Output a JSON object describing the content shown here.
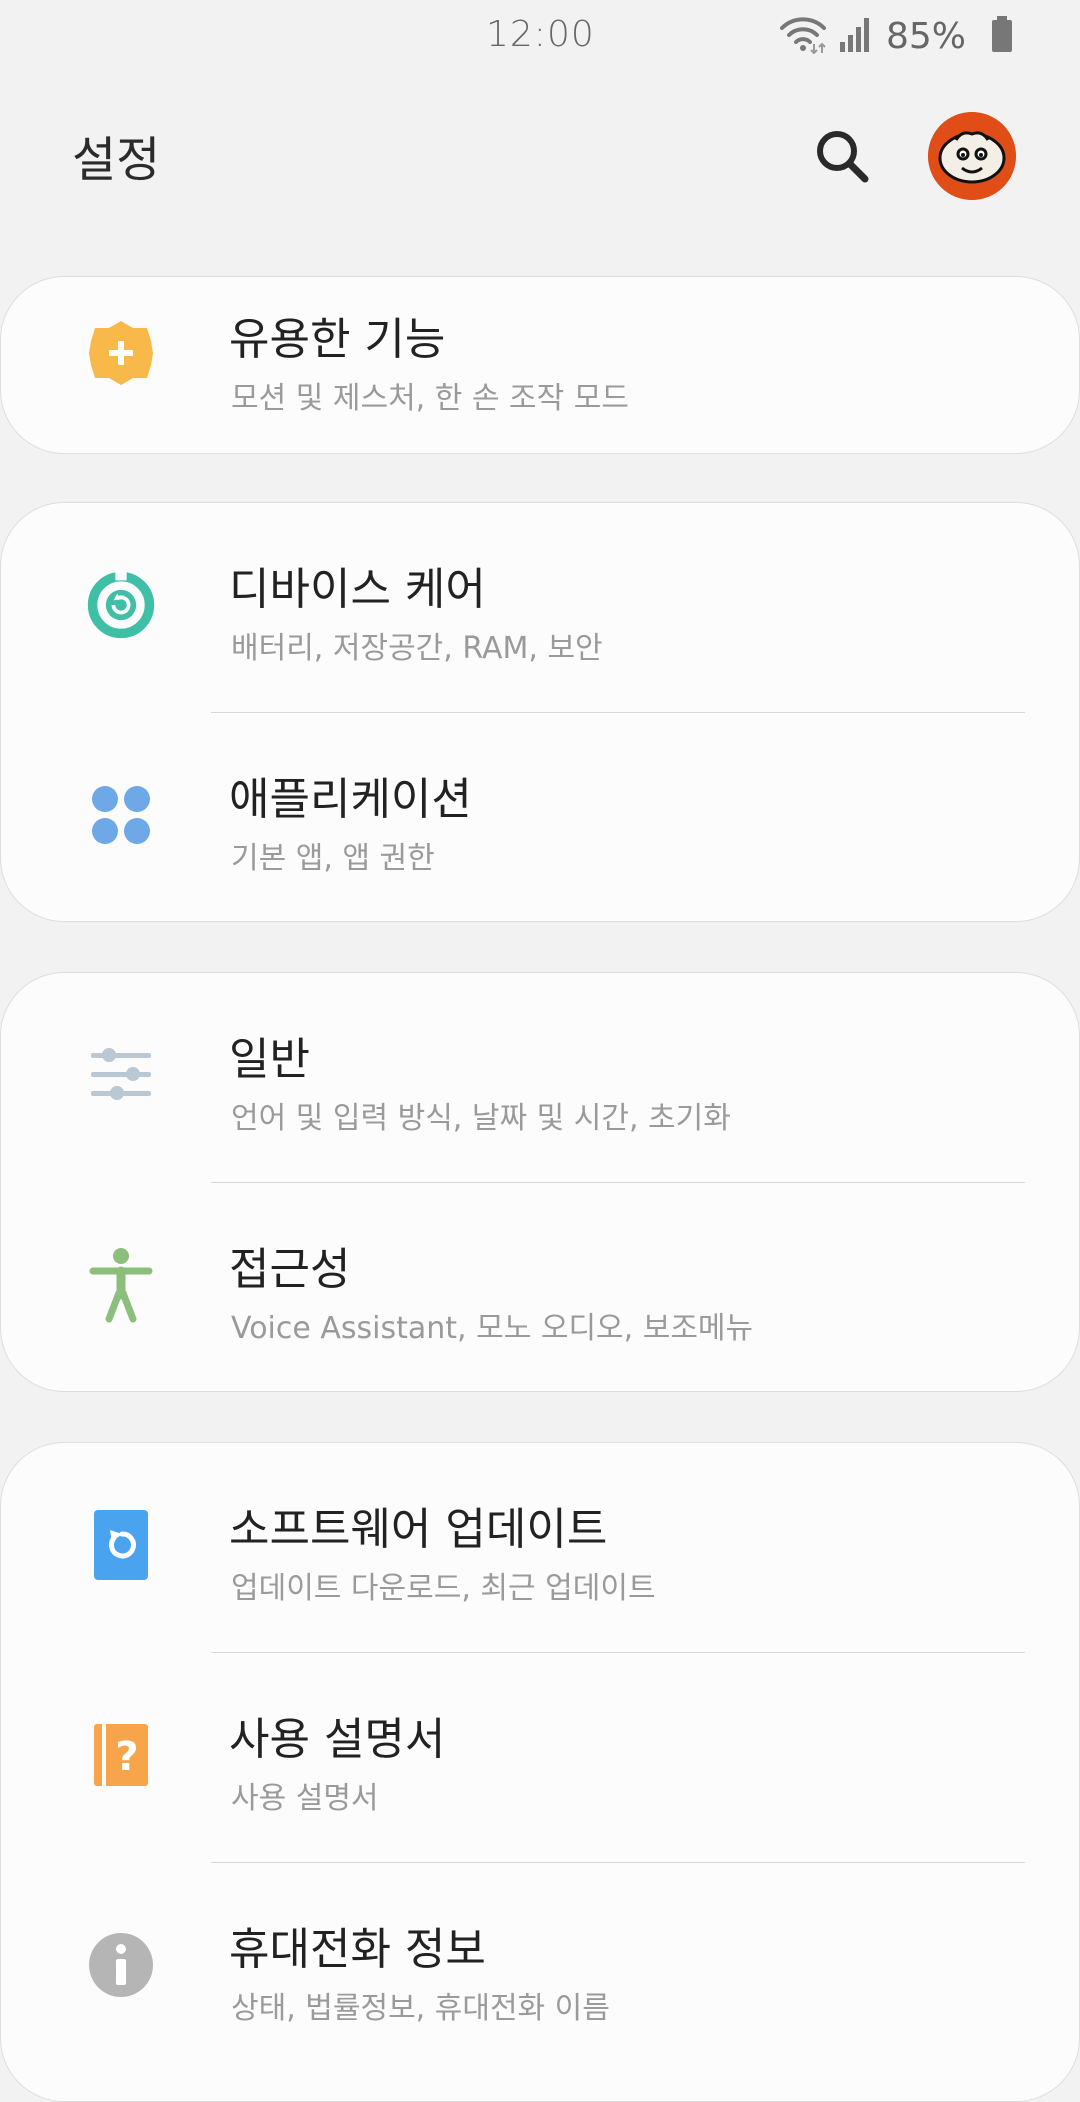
{
  "status_bar": {
    "time": "12:00",
    "battery_text": "85%",
    "icons": [
      "wifi-icon",
      "signal-icon",
      "battery-icon"
    ]
  },
  "header": {
    "title": "설정",
    "search_icon": "search-icon",
    "avatar_icon": "avatar-icon"
  },
  "colors": {
    "background": "#f2f2f2",
    "card": "#fcfcfc",
    "useful_features": "#f8b84a",
    "device_care": "#3fbfa5",
    "applications": "#6ea8e6",
    "general": "#b9c8d2",
    "accessibility": "#8cbf7c",
    "software_update": "#4aa3ee",
    "user_manual": "#f7a44a",
    "about_phone": "#b5b5b5",
    "avatar": "#e04d16"
  },
  "sections": [
    {
      "items": [
        {
          "title": "유용한 기능",
          "subtitle": "모션 및 제스처, 한 손 조작 모드",
          "icon": "gear-plus-icon"
        }
      ]
    },
    {
      "items": [
        {
          "title": "디바이스 케어",
          "subtitle": "배터리, 저장공간, RAM, 보안",
          "icon": "device-care-icon"
        },
        {
          "title": "애플리케이션",
          "subtitle": "기본 앱, 앱 권한",
          "icon": "apps-icon"
        }
      ]
    },
    {
      "items": [
        {
          "title": "일반",
          "subtitle": "언어 및 입력 방식, 날짜 및 시간, 초기화",
          "icon": "sliders-icon"
        },
        {
          "title": "접근성",
          "subtitle": "Voice Assistant, 모노 오디오, 보조메뉴",
          "icon": "accessibility-icon"
        }
      ]
    },
    {
      "items": [
        {
          "title": "소프트웨어 업데이트",
          "subtitle": "업데이트 다운로드, 최근 업데이트",
          "icon": "update-icon"
        },
        {
          "title": "사용 설명서",
          "subtitle": "사용 설명서",
          "icon": "manual-icon"
        },
        {
          "title": "휴대전화 정보",
          "subtitle": "상태, 법률정보, 휴대전화 이름",
          "icon": "info-icon"
        }
      ]
    }
  ]
}
